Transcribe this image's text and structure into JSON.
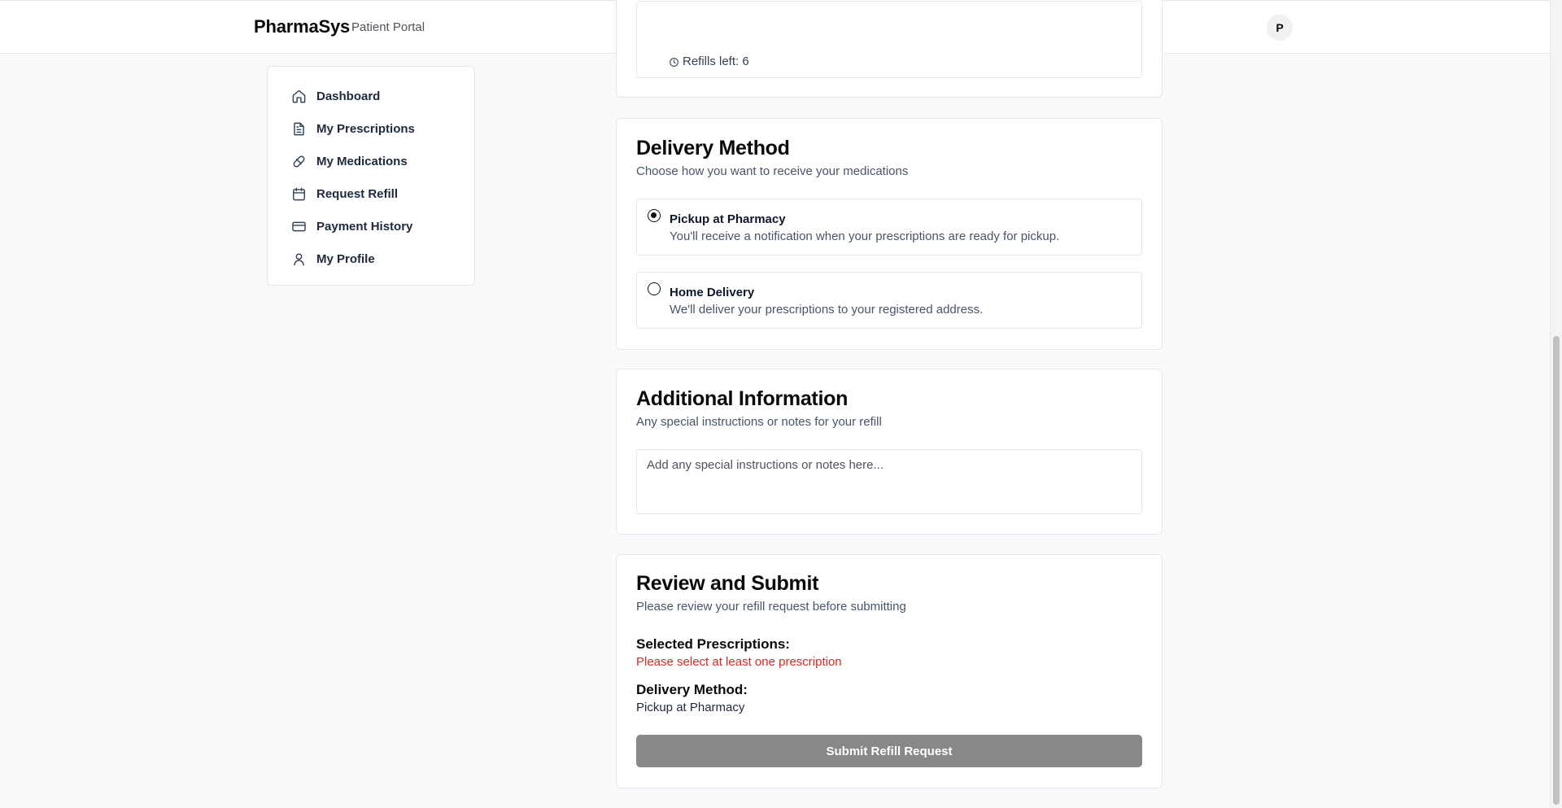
{
  "header": {
    "brand": "PharmaSys",
    "subtitle": "Patient Portal",
    "avatar_initial": "P"
  },
  "sidebar": {
    "items": [
      {
        "label": "Dashboard",
        "icon": "home-icon"
      },
      {
        "label": "My Prescriptions",
        "icon": "document-icon"
      },
      {
        "label": "My Medications",
        "icon": "pill-icon"
      },
      {
        "label": "Request Refill",
        "icon": "calendar-icon"
      },
      {
        "label": "Payment History",
        "icon": "credit-card-icon"
      },
      {
        "label": "My Profile",
        "icon": "user-icon"
      }
    ]
  },
  "prescription_card": {
    "refills_left": "Refills left: 6",
    "icon": "clock-icon"
  },
  "delivery": {
    "title": "Delivery Method",
    "subtitle": "Choose how you want to receive your medications",
    "options": [
      {
        "title": "Pickup at Pharmacy",
        "description": "You'll receive a notification when your prescriptions are ready for pickup.",
        "selected": true
      },
      {
        "title": "Home Delivery",
        "description": "We'll deliver your prescriptions to your registered address.",
        "selected": false
      }
    ]
  },
  "additional": {
    "title": "Additional Information",
    "subtitle": "Any special instructions or notes for your refill",
    "placeholder": "Add any special instructions or notes here...",
    "value": ""
  },
  "review": {
    "title": "Review and Submit",
    "subtitle": "Please review your refill request before submitting",
    "selected_heading": "Selected Prescriptions:",
    "selected_error": "Please select at least one prescription",
    "delivery_heading": "Delivery Method:",
    "delivery_value": "Pickup at Pharmacy",
    "submit_label": "Submit Refill Request"
  },
  "colors": {
    "error": "#dc2626",
    "button_disabled": "#888888"
  }
}
